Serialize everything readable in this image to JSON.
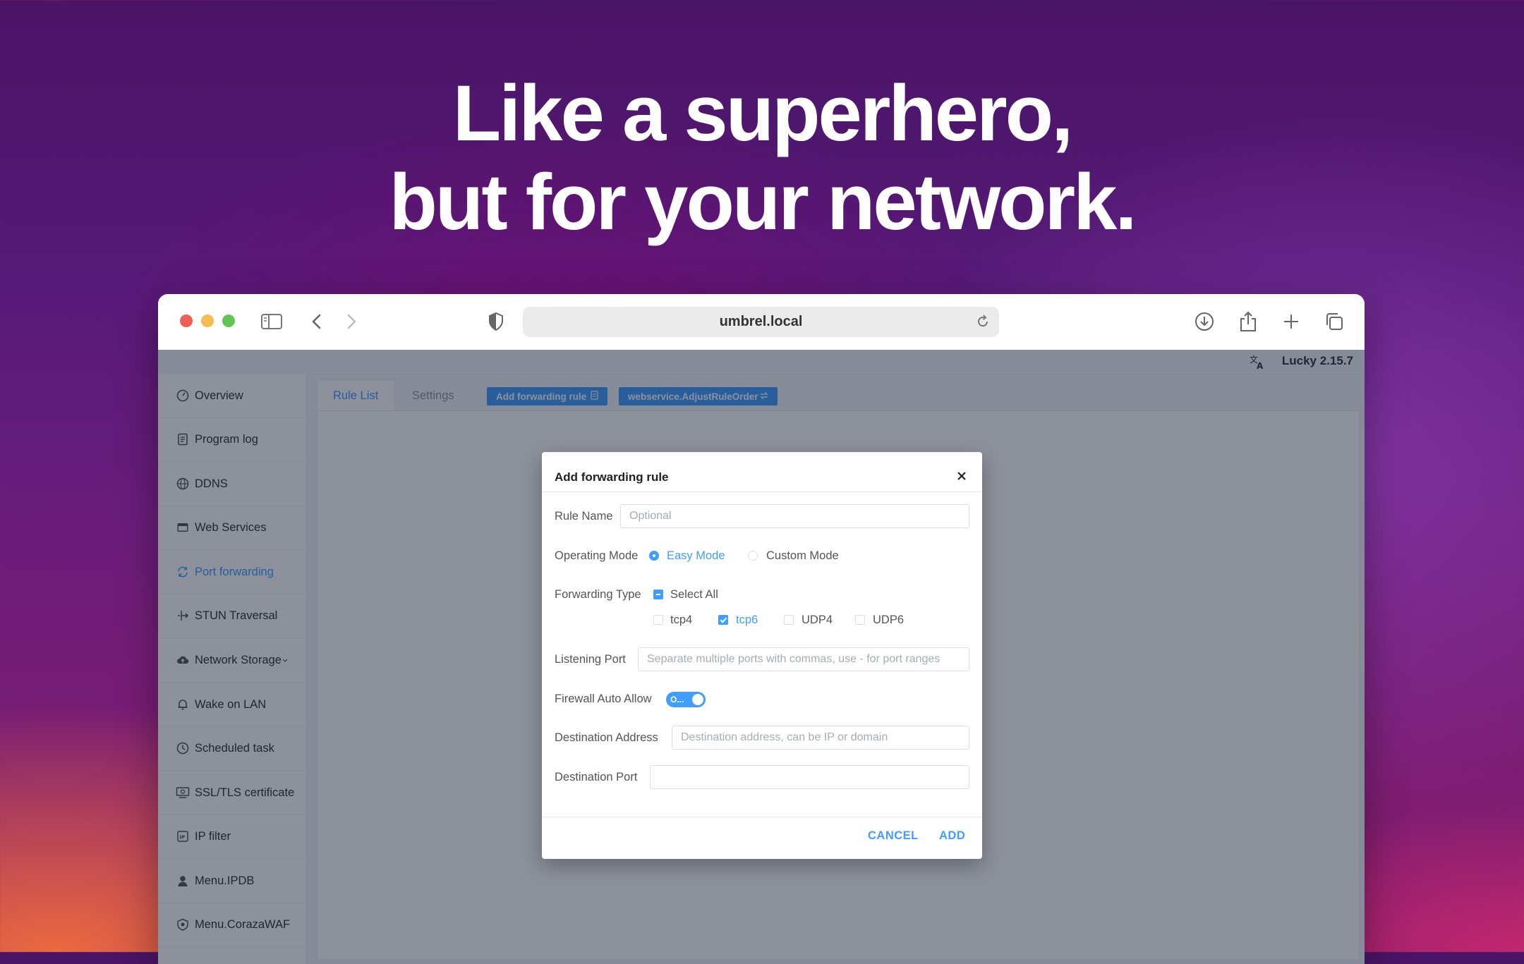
{
  "hero": {
    "line1": "Like a superhero,",
    "line2": "but for your network."
  },
  "browser": {
    "url": "umbrel.local"
  },
  "app": {
    "version": "Lucky 2.15.7",
    "sidebar": [
      {
        "label": "Overview",
        "icon": "dashboard-icon"
      },
      {
        "label": "Program log",
        "icon": "document-icon"
      },
      {
        "label": "DDNS",
        "icon": "dns-globe-icon"
      },
      {
        "label": "Web Services",
        "icon": "web-window-icon"
      },
      {
        "label": "Port forwarding",
        "icon": "refresh-arrows-icon",
        "active": true
      },
      {
        "label": "STUN Traversal",
        "icon": "route-icon"
      },
      {
        "label": "Network Storage",
        "icon": "cloud-upload-icon"
      },
      {
        "label": "Wake on LAN",
        "icon": "bell-icon"
      },
      {
        "label": "Scheduled task",
        "icon": "clock-icon"
      },
      {
        "label": "SSL/TLS certificate",
        "icon": "certificate-icon"
      },
      {
        "label": "IP filter",
        "icon": "ip-icon"
      },
      {
        "label": "Menu.IPDB",
        "icon": "user-icon"
      },
      {
        "label": "Menu.CorazaWAF",
        "icon": "shield-icon"
      }
    ],
    "tabs": {
      "rule_list": "Rule List",
      "settings": "Settings"
    },
    "actions": {
      "add_rule": "Add forwarding rule",
      "adjust_order": "webservice.AdjustRuleOrder"
    }
  },
  "dialog": {
    "title": "Add forwarding rule",
    "rule_name": {
      "label": "Rule Name",
      "placeholder": "Optional"
    },
    "operating_mode": {
      "label": "Operating Mode",
      "easy": "Easy Mode",
      "custom": "Custom Mode",
      "selected": "Easy Mode"
    },
    "forwarding_type": {
      "label": "Forwarding Type",
      "select_all": "Select All",
      "options": [
        {
          "label": "tcp4",
          "checked": false
        },
        {
          "label": "tcp6",
          "checked": true
        },
        {
          "label": "UDP4",
          "checked": false
        },
        {
          "label": "UDP6",
          "checked": false
        }
      ]
    },
    "listening_port": {
      "label": "Listening Port",
      "placeholder": "Separate multiple ports with commas, use - for port ranges"
    },
    "firewall": {
      "label": "Firewall Auto Allow",
      "switch_text": "O...",
      "on": true
    },
    "destination_address": {
      "label": "Destination Address",
      "placeholder": "Destination address, can be IP or domain"
    },
    "destination_port": {
      "label": "Destination Port",
      "placeholder": ""
    },
    "cancel": "CANCEL",
    "add": "ADD"
  }
}
